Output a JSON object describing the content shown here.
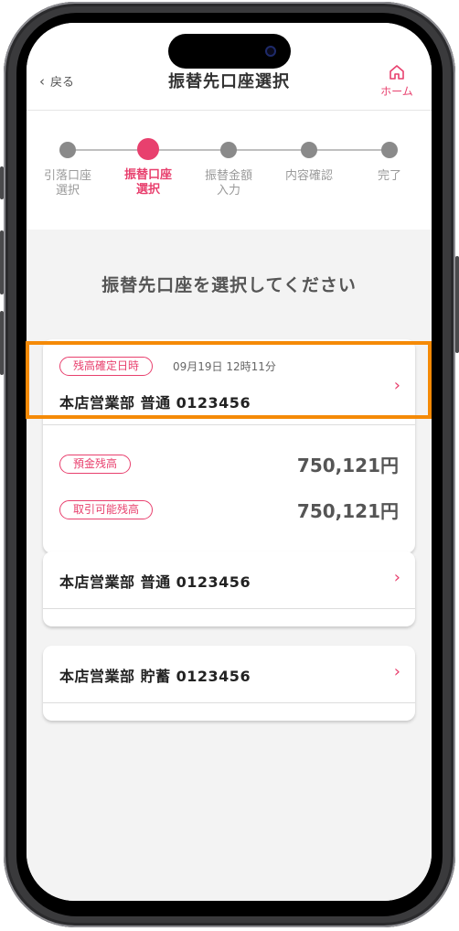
{
  "header": {
    "back_label": "戻る",
    "title": "振替先口座選択",
    "home_label": "ホーム"
  },
  "steps": [
    {
      "line1": "引落口座",
      "line2": "選択",
      "active": false
    },
    {
      "line1": "振替口座",
      "line2": "選択",
      "active": true
    },
    {
      "line1": "振替金額",
      "line2": "入力",
      "active": false
    },
    {
      "line1": "内容確認",
      "line2": "",
      "active": false
    },
    {
      "line1": "完了",
      "line2": "",
      "active": false
    }
  ],
  "section_title": "振替先口座を選択してください",
  "accounts": [
    {
      "date_badge": "残高確定日時",
      "date_text": "09月19日 12時11分",
      "name": "本店営業部  普通  0123456",
      "balances": [
        {
          "label": "預金残高",
          "amount": "750,121円"
        },
        {
          "label": "取引可能残高",
          "amount": "750,121円"
        }
      ]
    },
    {
      "name": "本店営業部  普通  0123456"
    },
    {
      "name": "本店営業部  貯蓄  0123456"
    }
  ],
  "colors": {
    "accent": "#e8406e",
    "highlight": "#f58a07",
    "background": "#f3f3f3"
  }
}
